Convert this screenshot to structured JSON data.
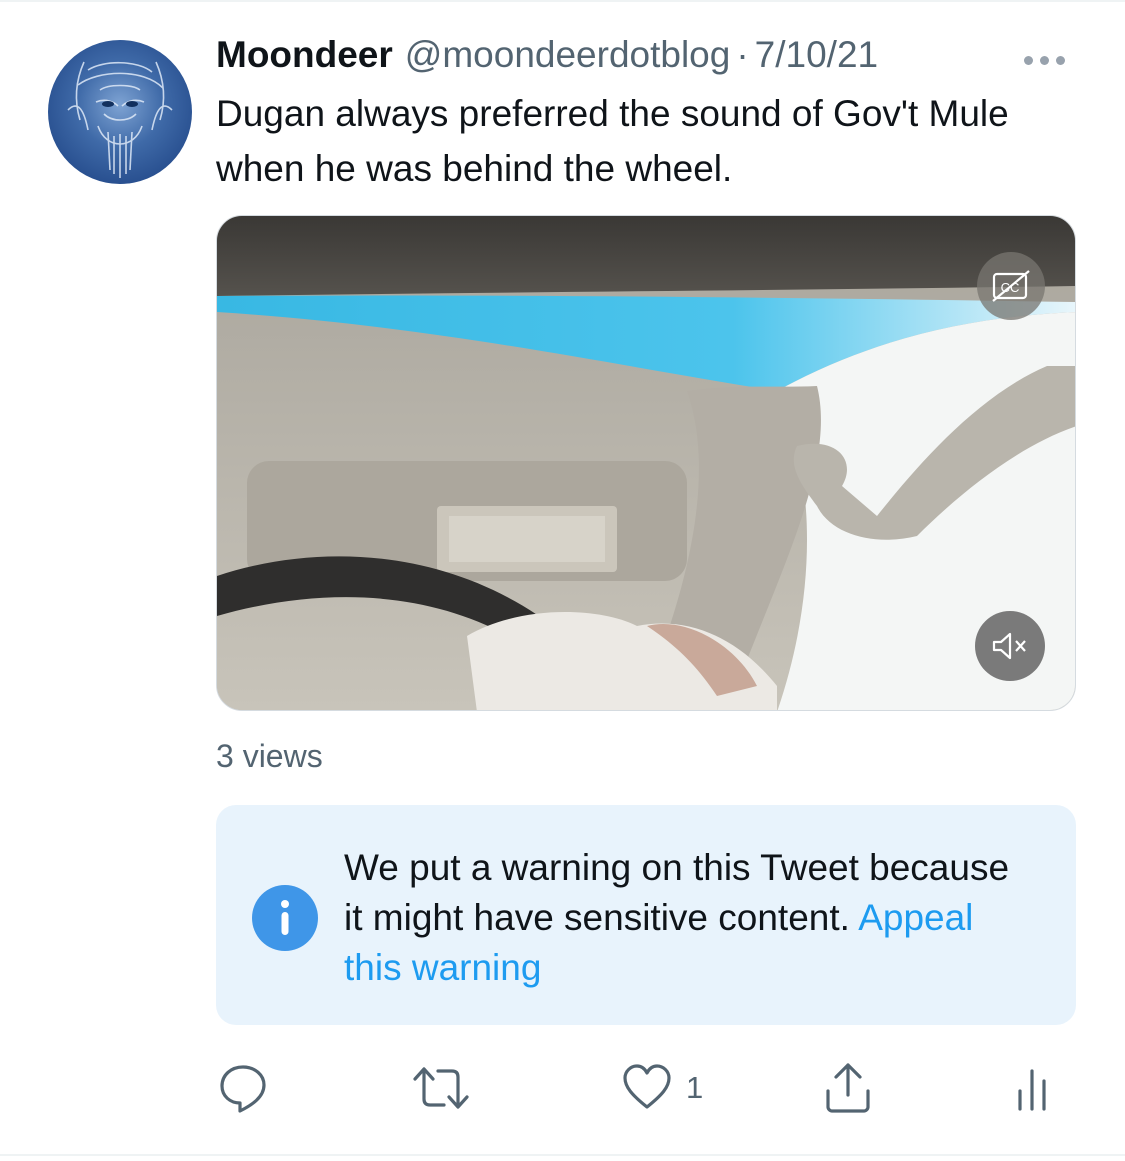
{
  "tweet": {
    "author_name": "Moondeer",
    "author_handle": "@moondeerdotblog",
    "separator": "·",
    "date": "7/10/21",
    "text": "Dugan always preferred the sound of Gov't Mule when he was behind the wheel.",
    "views": "3 views"
  },
  "warning": {
    "text": "We put a warning on this Tweet because it might have sensitive content.",
    "link_label": "Appeal this warning"
  },
  "actions": {
    "reply_icon": "reply-icon",
    "retweet_icon": "retweet-icon",
    "like_icon": "heart-icon",
    "like_count": "1",
    "share_icon": "share-icon",
    "analytics_icon": "analytics-icon"
  },
  "media": {
    "captions_icon": "closed-captions-off-icon",
    "mute_icon": "volume-muted-icon"
  },
  "colors": {
    "accent": "#1d9bf0",
    "warning_bg": "#e8f3fc",
    "secondary_text": "#536471"
  }
}
